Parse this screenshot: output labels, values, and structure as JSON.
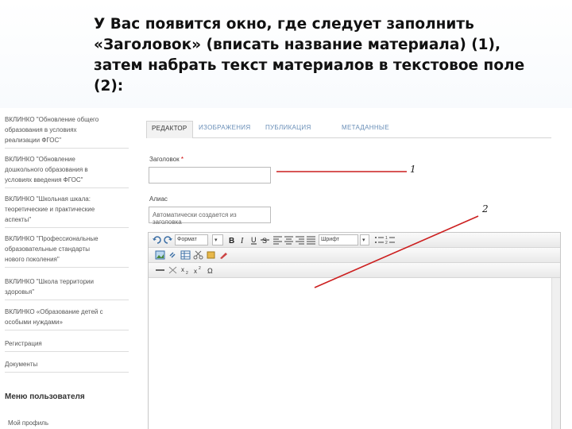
{
  "instruction": {
    "line1": "У Вас появится окно, где следует заполнить",
    "line2": "«Заголовок» (вписать название материала) (1),",
    "line3": "затем набрать текст материалов в текстовое поле",
    "line4": "(2):"
  },
  "sidebar": {
    "items": [
      {
        "label": "ВКЛИНКО \"Обновление общего\nобразования в условиях\nреализации ФГОС\""
      },
      {
        "label": "ВКЛИНКО \"Обновление\nдошкольного образования в\nусловиях введения ФГОС\""
      },
      {
        "label": "ВКЛИНКО \"Школьная шкала:\nтеоретические и практические\nаспекты\""
      },
      {
        "label": "ВКЛИНКО \"Профессиональные\nобразовательные стандарты\nнового поколения\""
      },
      {
        "label": "ВКЛИНКО \"Школа территории\nздоровья\""
      },
      {
        "label": "ВКЛИНКО «Образование детей с\nособыми нуждами»"
      },
      {
        "label": "Регистрация"
      },
      {
        "label": "Документы"
      }
    ],
    "user_menu_heading": "Меню пользователя",
    "user_menu_first": "Мой профиль"
  },
  "tabs": [
    {
      "label": "РЕДАКТОР"
    },
    {
      "label": "ИЗОБРАЖЕНИЯ"
    },
    {
      "label": "ПУБЛИКАЦИЯ"
    },
    {
      "label": "МЕТАДАННЫЕ"
    }
  ],
  "form": {
    "title_label": "Заголовок",
    "required_mark": "*",
    "title_value": "",
    "alias_label": "Алиас",
    "alias_placeholder": "Автоматически создается из заголовка"
  },
  "editor": {
    "format_select": "Формат",
    "font_select": "Шрифт"
  },
  "annotations": {
    "marker_1": "1",
    "marker_2": "2",
    "arrow_color": "#cc1f1f"
  }
}
